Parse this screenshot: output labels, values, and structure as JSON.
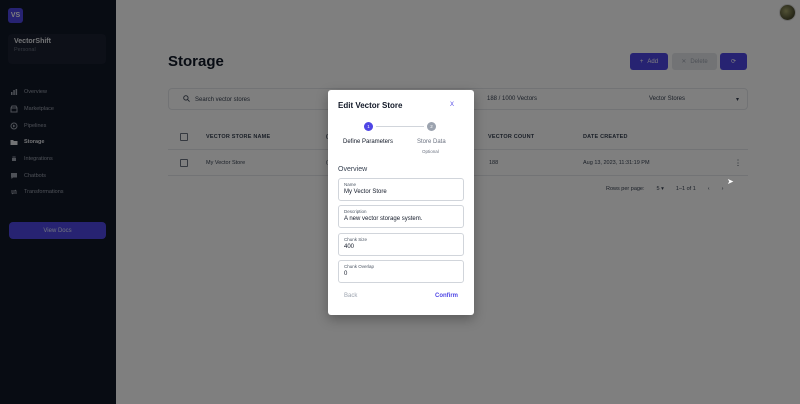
{
  "app": {
    "logo_text": "VS",
    "org_name": "VectorShift",
    "org_plan": "Personal"
  },
  "sidebar": {
    "items": [
      {
        "label": "Overview",
        "icon": "chart-icon"
      },
      {
        "label": "Marketplace",
        "icon": "store-icon"
      },
      {
        "label": "Pipelines",
        "icon": "pipeline-icon"
      },
      {
        "label": "Storage",
        "icon": "folder-icon",
        "active": true
      },
      {
        "label": "Integrations",
        "icon": "plug-icon"
      },
      {
        "label": "Chatbots",
        "icon": "chat-icon"
      },
      {
        "label": "Transformations",
        "icon": "transform-icon"
      }
    ],
    "docs_button": "View Docs"
  },
  "page": {
    "title": "Storage",
    "add_label": "Add",
    "delete_label": "Delete",
    "search_placeholder": "Search vector stores",
    "vector_count": "188 / 1000 Vectors",
    "store_type": "Vector Stores"
  },
  "table": {
    "headers": {
      "name": "VECTOR STORE NAME",
      "count": "VECTOR COUNT",
      "date": "DATE CREATED",
      "partial": "("
    },
    "rows": [
      {
        "name": "My Vector Store",
        "partial": "(",
        "count": "188",
        "date": "Aug 13, 2023, 11:31:19 PM"
      }
    ],
    "rows_per_page_label": "Rows per page:",
    "rows_per_page": "5",
    "range": "1–1 of 1"
  },
  "modal": {
    "title": "Edit Vector Store",
    "close": "X",
    "steps": [
      {
        "number": "1",
        "label": "Define Parameters"
      },
      {
        "number": "2",
        "label": "Store Data",
        "sub": "Optional"
      }
    ],
    "section": "Overview",
    "fields": {
      "name": {
        "label": "Name",
        "value": "My Vector Store"
      },
      "description": {
        "label": "Description",
        "value": "A new vector storage system."
      },
      "chunk_size": {
        "label": "Chunk Size",
        "value": "400"
      },
      "chunk_overlap": {
        "label": "Chunk Overlap",
        "value": "0"
      }
    },
    "back_label": "Back",
    "confirm_label": "Confirm"
  },
  "colors": {
    "accent": "#4f46e5",
    "sidebar_bg": "#111827"
  }
}
